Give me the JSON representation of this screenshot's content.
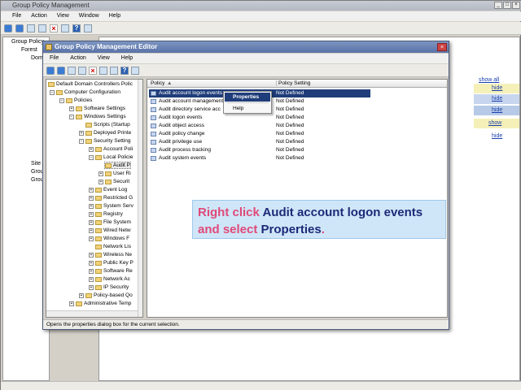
{
  "outer": {
    "title": "Group Policy Management",
    "menu": [
      "File",
      "Action",
      "View",
      "Window",
      "Help"
    ],
    "tree": [
      "Group Policy",
      "Forest",
      "Dom",
      "Site",
      "Grou",
      "Grou"
    ],
    "links": [
      "show all",
      "hide",
      "hide",
      "hide",
      "show",
      "hide"
    ]
  },
  "editor": {
    "title": "Group Policy Management Editor",
    "menu": [
      "File",
      "Action",
      "View",
      "Help"
    ],
    "tree": [
      "Default Domain Controllers Polic",
      "Computer Configuration",
      "Policies",
      "Software Settings",
      "Windows Settings",
      "Scripts (Startup",
      "Deployed Printe",
      "Security Setting",
      "Account Poli",
      "Local Policie",
      "Audit P",
      "User Ri",
      "Securit",
      "Event Log",
      "Restricted G",
      "System Serv",
      "Registry",
      "File System",
      "Wired Netw",
      "Windows F",
      "Network Lis",
      "Wireless Ne",
      "Public Key P",
      "Software Re",
      "Network Ac",
      "IP Security",
      "Policy-based Qo",
      "Administrative Temp"
    ],
    "columns": {
      "policy": "Policy",
      "setting": "Policy Setting"
    },
    "rows": [
      {
        "policy": "Audit account logon events",
        "setting": "Not Defined"
      },
      {
        "policy": "Audit account management",
        "setting": "Not Defined"
      },
      {
        "policy": "Audit directory service acc",
        "setting": "Not Defined"
      },
      {
        "policy": "Audit logon events",
        "setting": "Not Defined"
      },
      {
        "policy": "Audit object access",
        "setting": "Not Defined"
      },
      {
        "policy": "Audit policy change",
        "setting": "Not Defined"
      },
      {
        "policy": "Audit privilege use",
        "setting": "Not Defined"
      },
      {
        "policy": "Audit process tracking",
        "setting": "Not Defined"
      },
      {
        "policy": "Audit system events",
        "setting": "Not Defined"
      }
    ],
    "context_menu": {
      "properties": "Properties",
      "help": "Help"
    },
    "status": "Opens the properties dialog box for the current selection."
  },
  "callout": {
    "p1": "Right click ",
    "p2": "Audit account logon events",
    "p3": " and select ",
    "p4": "Properties",
    "p5": "."
  }
}
